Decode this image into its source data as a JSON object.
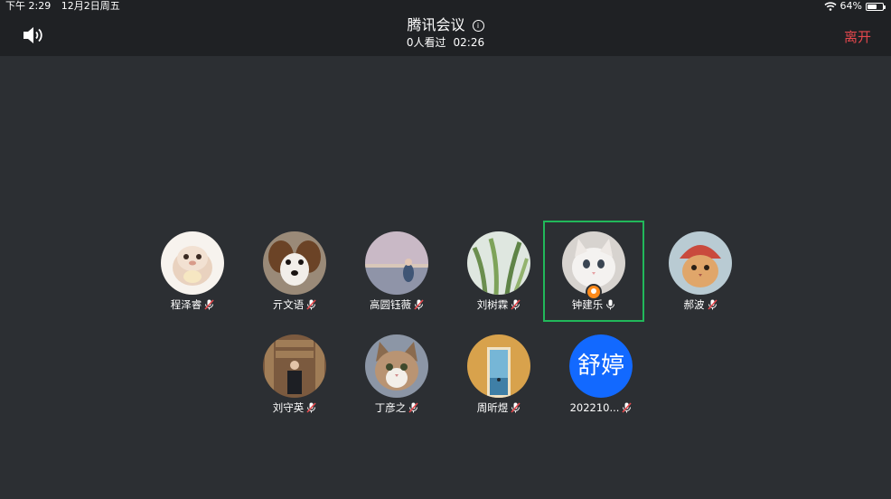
{
  "status": {
    "time": "下午 2:29",
    "date": "12月2日周五",
    "battery": "64%",
    "battery_level": 0.64
  },
  "header": {
    "title": "腾讯会议",
    "viewers": "0人看过",
    "duration": "02:26",
    "leave_label": "离开"
  },
  "participants": [
    {
      "name": "程泽睿",
      "muted": true,
      "avatar": "hamster"
    },
    {
      "name": "亓文语",
      "muted": true,
      "avatar": "dog"
    },
    {
      "name": "高圆钰薇",
      "muted": true,
      "avatar": "beach"
    },
    {
      "name": "刘树霖",
      "muted": true,
      "avatar": "plant"
    },
    {
      "name": "钟建乐",
      "muted": false,
      "avatar": "white-cat",
      "host": true,
      "active": true
    },
    {
      "name": "郝波",
      "muted": true,
      "avatar": "cat-costume"
    },
    {
      "name": "刘守英",
      "muted": true,
      "avatar": "library"
    },
    {
      "name": "丁彦之",
      "muted": true,
      "avatar": "tabby-cat"
    },
    {
      "name": "周昕煜",
      "muted": true,
      "avatar": "door"
    },
    {
      "name": "202210...",
      "muted": true,
      "avatar": "text",
      "avatar_text": "舒婷"
    }
  ],
  "colors": {
    "accent_green": "#21b85a",
    "leave_red": "#e5484d",
    "avatar_blue": "#1269ff",
    "host_orange": "#ff8a1a"
  }
}
